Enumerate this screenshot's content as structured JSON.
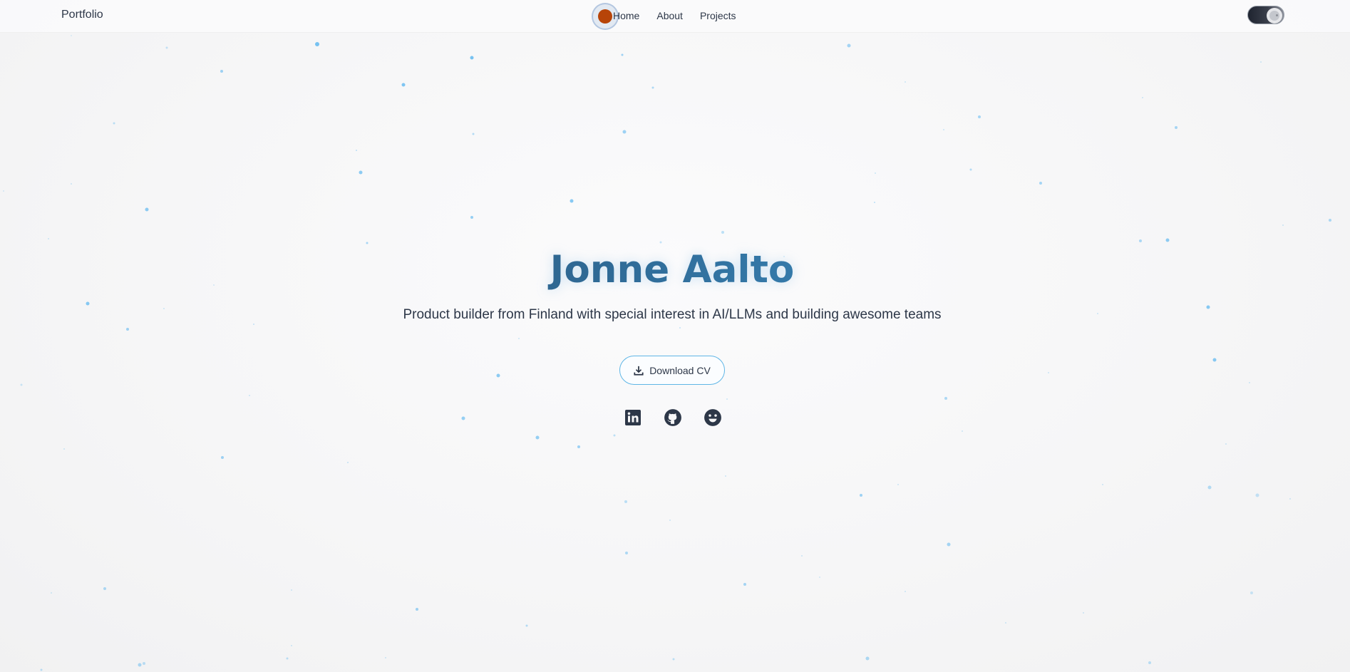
{
  "nav": {
    "brand": "Portfolio",
    "links": [
      {
        "label": "Home"
      },
      {
        "label": "About"
      },
      {
        "label": "Projects"
      }
    ]
  },
  "cursor": {
    "color": "#b74408"
  },
  "theme_toggle": {
    "icon": "moon-icon",
    "mode": "dark"
  },
  "hero": {
    "title": "Jonne Aalto",
    "subtitle": "Product builder from Finland with special interest in AI/LLMs and building awesome teams",
    "cta_label": "Download CV",
    "cta_icon": "download-icon"
  },
  "socials": [
    {
      "icon": "linkedin-icon"
    },
    {
      "icon": "github-icon"
    },
    {
      "icon": "smiley-icon"
    }
  ],
  "colors": {
    "accent": "#44a6e2",
    "title_start": "#2f4b6b",
    "text": "#2d3748",
    "particle": "#60b8f0"
  }
}
